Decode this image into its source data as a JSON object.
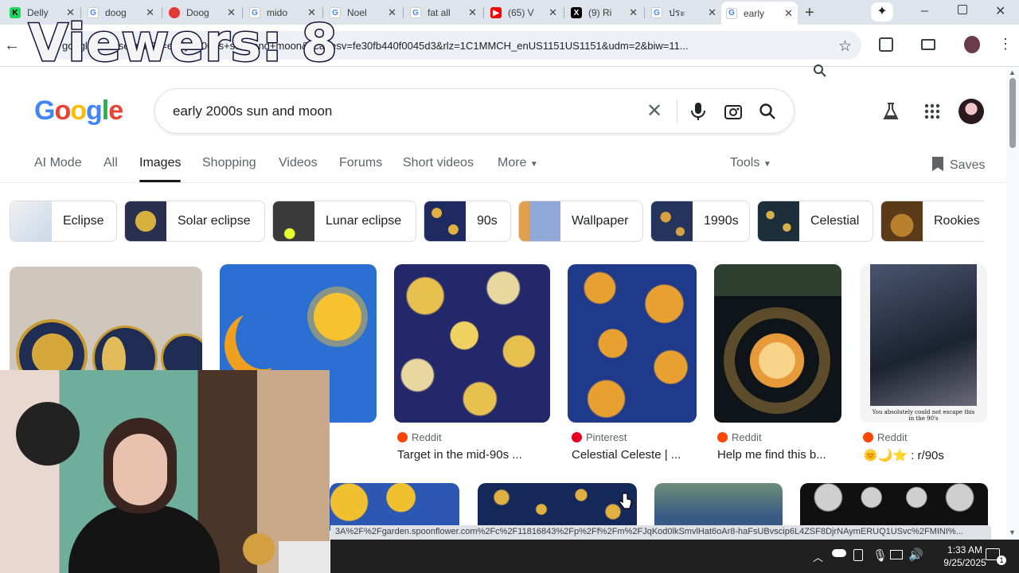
{
  "tabs": [
    {
      "title": "Delly",
      "color": "#1ed760",
      "glyph": "K"
    },
    {
      "title": "doog",
      "color": "#4285f4",
      "glyph": "G"
    },
    {
      "title": "Doog",
      "color": "#e53935",
      "glyph": "●"
    },
    {
      "title": "mido",
      "color": "#4285f4",
      "glyph": "G"
    },
    {
      "title": "Noel",
      "color": "#4285f4",
      "glyph": "G"
    },
    {
      "title": "fat all",
      "color": "#4285f4",
      "glyph": "G"
    },
    {
      "title": "(65) V",
      "color": "#ff0000",
      "glyph": "▶"
    },
    {
      "title": "(9) Ri",
      "color": "#000000",
      "glyph": "X"
    },
    {
      "title": "ประ",
      "color": "#4285f4",
      "glyph": "G"
    },
    {
      "title": "early",
      "color": "#4285f4",
      "glyph": "G"
    }
  ],
  "omnibox": {
    "url": "google.com/search?q=early+2000s+sun+and+moon&sca_esv=fe30fb440f0045d3&rlz=1C1MMCH_enUS1151US1151&udm=2&biw=11..."
  },
  "overlay": {
    "viewers": "Viewers: 8"
  },
  "google": {
    "logo": "Google",
    "query": "early 2000s sun and moon",
    "saves": "Saves",
    "tools": "Tools"
  },
  "nav": [
    "AI Mode",
    "All",
    "Images",
    "Shopping",
    "Videos",
    "Forums",
    "Short videos",
    "More"
  ],
  "chips": [
    "Eclipse",
    "Solar eclipse",
    "Lunar eclipse",
    "90s",
    "Wallpaper",
    "1990s",
    "Celestial",
    "Rookies"
  ],
  "results": [
    {
      "source": "Reddit",
      "caption": "Target in the mid-90s ..."
    },
    {
      "source": "Pinterest",
      "caption": "Celestial Celeste | ..."
    },
    {
      "source": "Reddit",
      "caption": "Help me find this b..."
    },
    {
      "source": "Reddit",
      "caption": "🌞🌙⭐ : r/90s"
    }
  ],
  "poster_text": "You absolutely could not escape this in the 90's",
  "status_url": "3A%2F%2Fgarden.spoonflower.com%2Fc%2F11816843%2Fp%2Ff%2Fm%2FJqKod0lkSmvlHat6oAr8-haFsUBvscip6L4ZSF8DjrNAymERUQ1USvc%2FMINI%...",
  "taskbar": {
    "time": "1:33 AM",
    "date": "9/25/2025",
    "notif_count": "1"
  }
}
